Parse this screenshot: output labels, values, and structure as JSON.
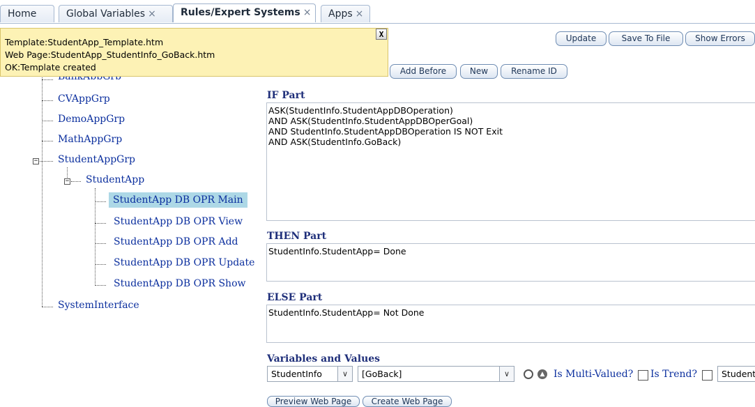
{
  "tabs": [
    {
      "label": "Home",
      "closable": false
    },
    {
      "label": "Global Variables",
      "closable": true
    },
    {
      "label": "Rules/Expert Systems",
      "closable": true,
      "active": true
    },
    {
      "label": "Apps",
      "closable": true
    }
  ],
  "close_glyph": "×",
  "message": {
    "lines": [
      "Template:StudentApp_Template.htm",
      "Web Page:StudentApp_StudentInfo_GoBack.htm",
      "OK:Template created"
    ],
    "close_label": "X"
  },
  "toolbar": {
    "update": "Update",
    "save_to_file": "Save To File",
    "show_errors": "Show Errors",
    "add_before": "Add Before",
    "new": "New",
    "rename_id": "Rename ID"
  },
  "tree": {
    "partial_top": "BankAppGrp",
    "groups": [
      "CVAppGrp",
      "DemoAppGrp",
      "MathAppGrp",
      "StudentAppGrp"
    ],
    "subgroup": "StudentApp",
    "rules": [
      "StudentApp DB OPR Main",
      "StudentApp DB OPR View",
      "StudentApp DB OPR Add",
      "StudentApp DB OPR Update",
      "StudentApp DB OPR Show"
    ],
    "selected_rule": "StudentApp DB OPR Main",
    "last": "SystemInterface"
  },
  "if_part": {
    "heading": "IF Part",
    "lines": [
      "ASK(StudentInfo.StudentAppDBOperation)",
      "AND ASK(StudentInfo.StudentAppDBOperGoal)",
      "AND StudentInfo.StudentAppDBOperation IS NOT Exit",
      "AND ASK(StudentInfo.GoBack)"
    ]
  },
  "then_part": {
    "heading": "THEN Part",
    "lines": [
      "StudentInfo.StudentApp= Done"
    ]
  },
  "else_part": {
    "heading": "ELSE Part",
    "lines": [
      "StudentInfo.StudentApp= Not Done"
    ]
  },
  "variables": {
    "heading": "Variables and Values",
    "object_select": "StudentInfo",
    "variable_select": "[GoBack]",
    "multi_valued_label": "Is Multi-Valued?",
    "is_trend_label": "Is Trend?",
    "partial_field": "Student"
  },
  "bottom_buttons": {
    "preview": "Preview Web Page",
    "create": "Create Web Page"
  },
  "colors": {
    "tooltip_bg": "#fdf2b5",
    "selected_bg": "#add8e6",
    "link_blue": "#0b2f9e",
    "heading_blue": "#1f2f7a"
  }
}
